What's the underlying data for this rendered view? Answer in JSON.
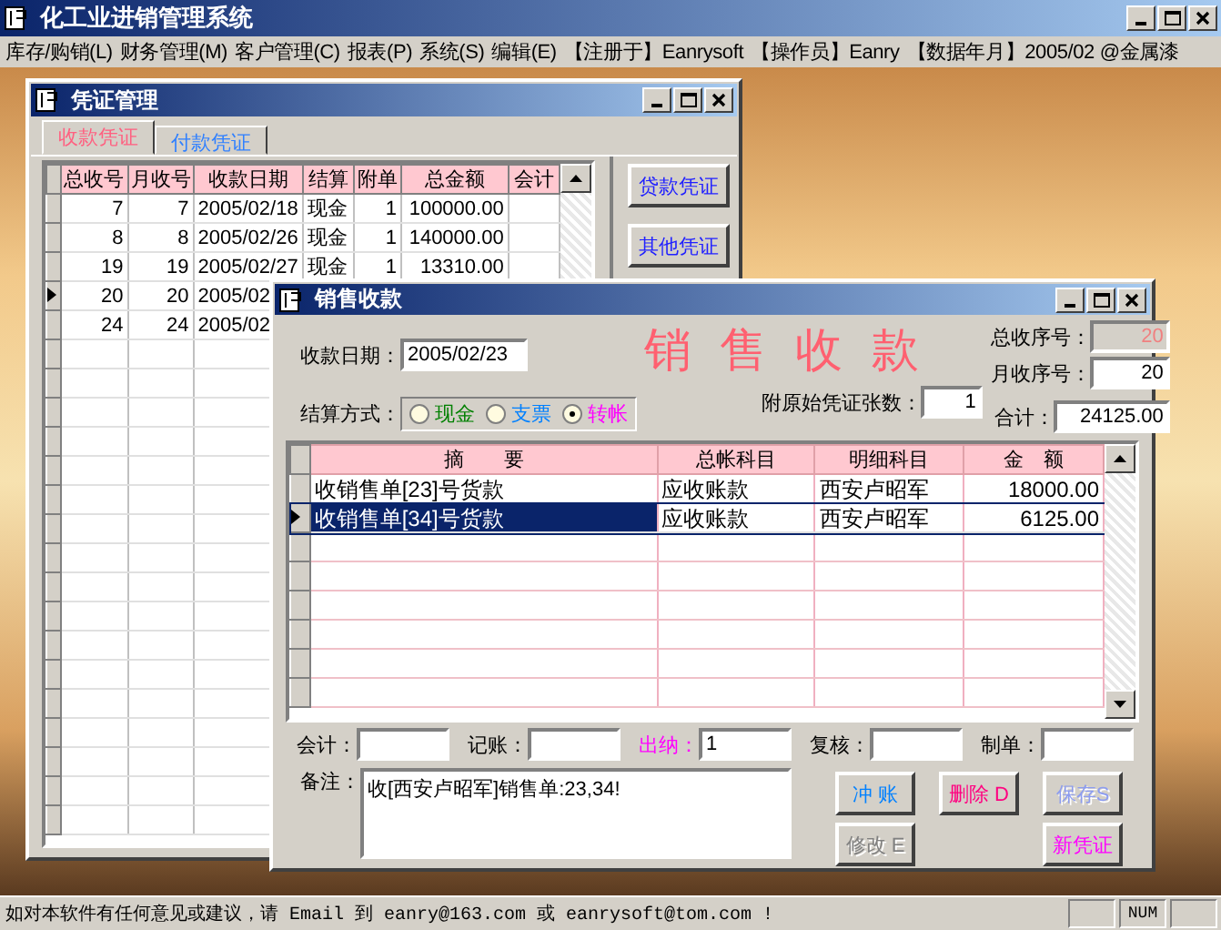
{
  "app": {
    "title": "化工业进销管理系统"
  },
  "menu": [
    "库存/购销(L)",
    "财务管理(M)",
    "客户管理(C)",
    "报表(P)",
    "系统(S)",
    "编辑(E)"
  ],
  "menu_info": [
    "【注册于】Eanrysoft",
    "【操作员】Eanry",
    "【数据年月】2005/02 @金属漆"
  ],
  "voucher_window": {
    "title": "凭证管理",
    "tabs": [
      {
        "label": "收款凭证",
        "selected": true
      },
      {
        "label": "付款凭证",
        "selected": false
      }
    ],
    "table": {
      "columns": [
        "总收号",
        "月收号",
        "收款日期",
        "结算",
        "附单",
        "总金额",
        "会计"
      ],
      "rows": [
        {
          "current": false,
          "cells": [
            "7",
            "7",
            "2005/02/18",
            "现金",
            "1",
            "100000.00"
          ]
        },
        {
          "current": false,
          "cells": [
            "8",
            "8",
            "2005/02/26",
            "现金",
            "1",
            "140000.00"
          ]
        },
        {
          "current": false,
          "cells": [
            "19",
            "19",
            "2005/02/27",
            "现金",
            "1",
            "13310.00"
          ]
        },
        {
          "current": true,
          "cells": [
            "20",
            "20",
            "2005/02"
          ]
        },
        {
          "current": false,
          "cells": [
            "24",
            "24",
            "2005/02"
          ]
        }
      ]
    },
    "buttons": [
      "贷款凭证",
      "其他凭证"
    ]
  },
  "sales_window": {
    "title": "销售收款",
    "heading": "销售收款",
    "date": {
      "label": "收款日期：",
      "value": "2005/02/23"
    },
    "total_no": {
      "label": "总收序号：",
      "value": "20",
      "disabled": true
    },
    "month_no": {
      "label": "月收序号：",
      "value": "20",
      "disabled": false
    },
    "payment": {
      "label": "结算方式：",
      "options": [
        {
          "label": "现金",
          "selected": false,
          "color": "#008000"
        },
        {
          "label": "支票",
          "selected": false,
          "color": "#0080ff"
        },
        {
          "label": "转帐",
          "selected": true,
          "color": "#ff00ff"
        }
      ]
    },
    "attachments": {
      "label": "附原始凭证张数：",
      "value": "1"
    },
    "total": {
      "label": "合计：",
      "value": "24125.00"
    },
    "table": {
      "columns": [
        "摘　　要",
        "总帐科目",
        "明细科目",
        "金　额"
      ],
      "rows": [
        {
          "selected": false,
          "cells": [
            "收销售单[23]号货款",
            "应收账款",
            "西安卢昭军",
            "18000.00"
          ]
        },
        {
          "selected": true,
          "cells": [
            "收销售单[34]号货款",
            "应收账款",
            "西安卢昭军",
            "6125.00"
          ]
        }
      ]
    },
    "signatures": [
      {
        "label": "会计：",
        "highlight": false
      },
      {
        "label": "记账：",
        "highlight": false
      },
      {
        "label": "出纳：",
        "value": "1",
        "highlight": true
      },
      {
        "label": "复核：",
        "highlight": false
      },
      {
        "label": "制单：",
        "highlight": false
      }
    ],
    "notes": {
      "label": "备注：",
      "value": "收[西安卢昭军]销售单:23,34!"
    },
    "buttons": [
      {
        "label": "冲 账",
        "color": "#0080ff",
        "disabled": false
      },
      {
        "label": "删除 D",
        "color": "#ff0080",
        "disabled": false
      },
      {
        "label": "保存S",
        "color": "#8c9cf0",
        "disabled": true
      },
      {
        "label": "修改 E",
        "color": "#808080",
        "disabled": true
      },
      {
        "label": "新凭证",
        "color": "#ff00ff",
        "disabled": false
      }
    ]
  },
  "status_bar": {
    "message": "如对本软件有任何意见或建议，请 Email 到 eanry@163.com 或 eanrysoft@tom.com !",
    "panels": [
      "NUM"
    ]
  }
}
